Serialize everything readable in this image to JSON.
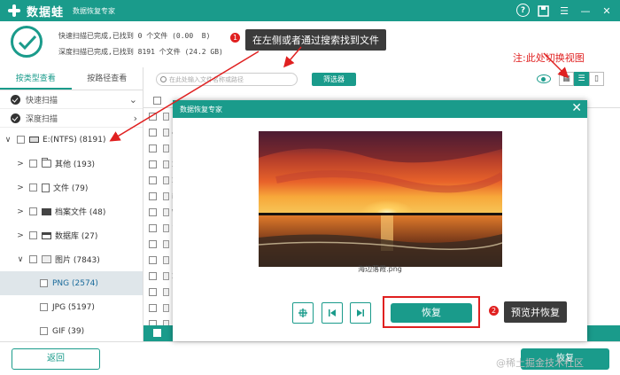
{
  "app": {
    "brand": "数据蛙",
    "subtitle": "数据恢复专家"
  },
  "status": {
    "quick_scan_line": "快速扫描已完成,已找到 0 个文件 (0.00  B)",
    "deep_scan_line": "深度扫描已完成,已找到 8191 个文件 (24.2 GB)"
  },
  "annotations": {
    "callout1_badge": "1",
    "callout1_text": "在左侧或者通过搜索找到文件",
    "note": "注:此处切换视图",
    "callout2_badge": "2",
    "callout2_text": "预览并恢复"
  },
  "sidebar": {
    "tabs": [
      "按类型查看",
      "按路径查看"
    ],
    "scans": [
      {
        "label": "快速扫描"
      },
      {
        "label": "深度扫描"
      }
    ],
    "tree": [
      {
        "label": "E:(NTFS) (8191)",
        "arrow": "∨",
        "icon": "drive",
        "indent": 4
      },
      {
        "label": "其他 (193)",
        "arrow": ">",
        "icon": "folder",
        "indent": 18
      },
      {
        "label": "文件 (79)",
        "arrow": ">",
        "icon": "doc",
        "indent": 18
      },
      {
        "label": "档案文件 (48)",
        "arrow": ">",
        "icon": "archive",
        "indent": 18
      },
      {
        "label": "数据库 (27)",
        "arrow": ">",
        "icon": "db",
        "indent": 18
      },
      {
        "label": "图片 (7843)",
        "arrow": "∨",
        "icon": "img",
        "indent": 18
      },
      {
        "label": "PNG (2574)",
        "arrow": "",
        "icon": "",
        "indent": 40,
        "selected": true
      },
      {
        "label": "JPG (5197)",
        "arrow": "",
        "icon": "",
        "indent": 40
      },
      {
        "label": "GIF (39)",
        "arrow": "",
        "icon": "",
        "indent": 40
      }
    ]
  },
  "toolbar": {
    "search_placeholder": "在此处输入文件名称或路径",
    "filter_label": "筛选器"
  },
  "list": {
    "row_letters": [
      "",
      "4",
      "",
      "2",
      "2",
      "i",
      "W",
      "1",
      "",
      "",
      "2",
      "",
      "",
      "",
      ""
    ]
  },
  "modal": {
    "title": "数据恢复专家",
    "filename": "海边落霞.png",
    "recover_label": "恢复"
  },
  "bottom": {
    "back_label": "返回",
    "recover_label": "恢复",
    "watermark": "@稀土掘金技术社区"
  },
  "colors": {
    "accent": "#1a9b8b",
    "annotation_red": "#e02020"
  }
}
